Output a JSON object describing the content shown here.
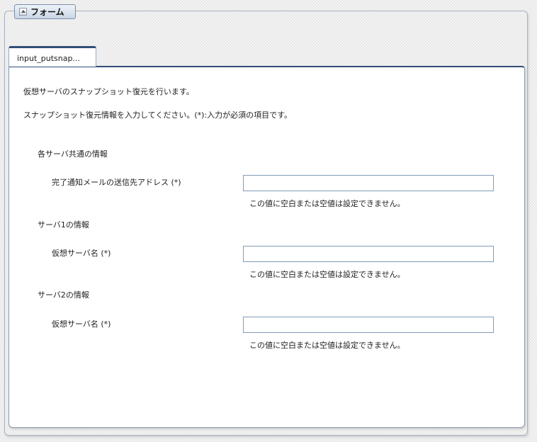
{
  "header": {
    "form_button_label": "フォーム",
    "collapse_icon": "collapse-up-icon"
  },
  "tabs": [
    {
      "label": "input_putsnap..."
    }
  ],
  "main": {
    "description_1": "仮想サーバのスナップショット復元を行います。",
    "description_2": "スナップショット復元情報を入力してください。(*):入力が必須の項目です。",
    "sections": [
      {
        "heading": "各サーバ共通の情報",
        "field_label": "完了通知メールの送信先アドレス (*)",
        "input_value": "",
        "error": "この値に空白または空値は設定できません。"
      },
      {
        "heading": "サーバ1の情報",
        "field_label": "仮想サーバ名 (*)",
        "input_value": "",
        "error": "この値に空白または空値は設定できません。"
      },
      {
        "heading": "サーバ2の情報",
        "field_label": "仮想サーバ名 (*)",
        "input_value": "",
        "error": "この値に空白または空値は設定できません。"
      }
    ]
  },
  "colors": {
    "tab_accent": "#2f4f78",
    "input_border": "#7f9db9",
    "panel_border": "#a8b3c2"
  }
}
